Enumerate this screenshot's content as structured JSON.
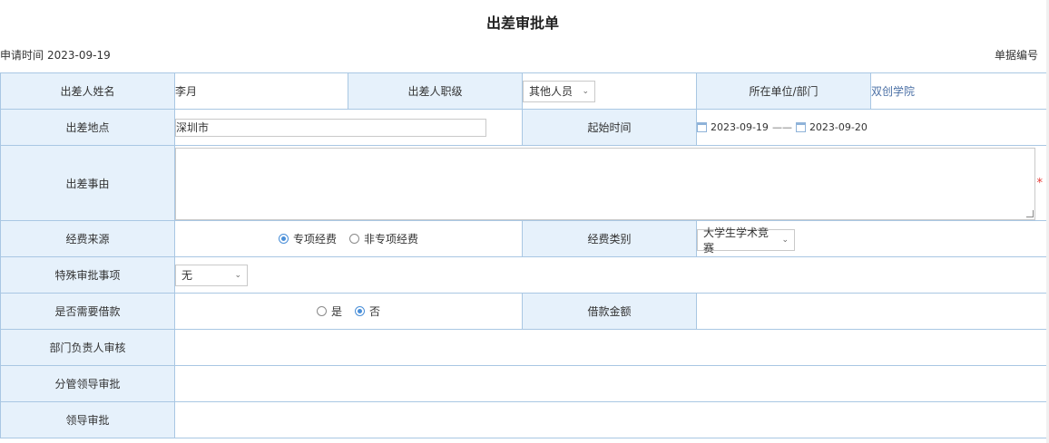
{
  "title": "出差审批单",
  "meta": {
    "apply_time_label": "申请时间",
    "apply_time_value": "2023-09-19",
    "doc_no_label": "单据编号"
  },
  "row1": {
    "name_label": "出差人姓名",
    "name_value": "李月",
    "rank_label": "出差人职级",
    "rank_value": "其他人员",
    "dept_label": "所在单位/部门",
    "dept_value": "双创学院"
  },
  "row2": {
    "place_label": "出差地点",
    "place_value": "深圳市",
    "time_label": "起始时间",
    "start_date": "2023-09-19",
    "range_sep": "——",
    "end_date": "2023-09-20"
  },
  "row3": {
    "reason_label": "出差事由",
    "reason_value": "",
    "required_mark": "*"
  },
  "row4": {
    "fund_source_label": "经费来源",
    "fund_source_options": [
      "专项经费",
      "非专项经费"
    ],
    "fund_source_selected": "专项经费",
    "fund_type_label": "经费类别",
    "fund_type_value": "大学生学术竞赛"
  },
  "row5": {
    "special_label": "特殊审批事项",
    "special_value": "无"
  },
  "row6": {
    "loan_label": "是否需要借款",
    "loan_options": [
      "是",
      "否"
    ],
    "loan_selected": "否",
    "loan_amount_label": "借款金额"
  },
  "row7": {
    "dept_head_label": "部门负责人审核"
  },
  "row8": {
    "lead_label": "分管领导审批"
  },
  "row9": {
    "leader_label": "领导审批"
  },
  "colors": {
    "label_bg": "#e6f1fb",
    "border": "#a9c7e3",
    "radio_accent": "#4a8fd8",
    "required": "#e53935"
  }
}
